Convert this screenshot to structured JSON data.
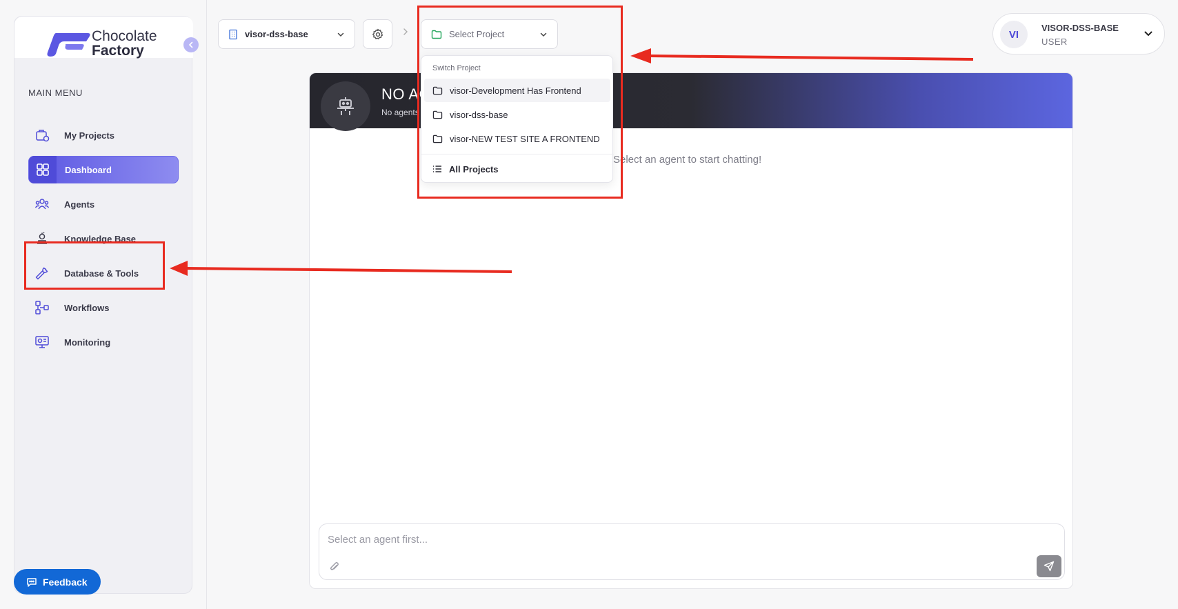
{
  "brand": {
    "line1": "Chocolate",
    "line2": "Factory"
  },
  "sidebar": {
    "heading": "MAIN MENU",
    "items": [
      {
        "label": "My Projects",
        "icon": "projects-icon"
      },
      {
        "label": "Dashboard",
        "icon": "dashboard-icon",
        "active": true
      },
      {
        "label": "Agents",
        "icon": "agents-icon"
      },
      {
        "label": "Knowledge Base",
        "icon": "knowledge-base-icon"
      },
      {
        "label": "Database & Tools",
        "icon": "wrench-icon"
      },
      {
        "label": "Workflows",
        "icon": "workflows-icon"
      },
      {
        "label": "Monitoring",
        "icon": "monitoring-icon"
      }
    ],
    "feedback_label": "Feedback"
  },
  "topbar": {
    "workspace": "visor-dss-base",
    "project_placeholder": "Select Project"
  },
  "user": {
    "initials": "VI",
    "name": "VISOR-DSS-BASE",
    "role": "USER"
  },
  "dropdown": {
    "title": "Switch Project",
    "projects": [
      "visor-Development Has Frontend",
      "visor-dss-base",
      "visor-NEW TEST SITE A FRONTEND"
    ],
    "all_label": "All Projects"
  },
  "chat": {
    "agent_title": "NO AG",
    "agent_subtitle": "No agents",
    "empty_message": "Select an agent to start chatting!",
    "input_placeholder": "Select an agent first..."
  },
  "colors": {
    "accent": "#5b57e2",
    "feedback": "#1268d6",
    "annotation": "#e82b20",
    "folder_green": "#22a55a"
  }
}
